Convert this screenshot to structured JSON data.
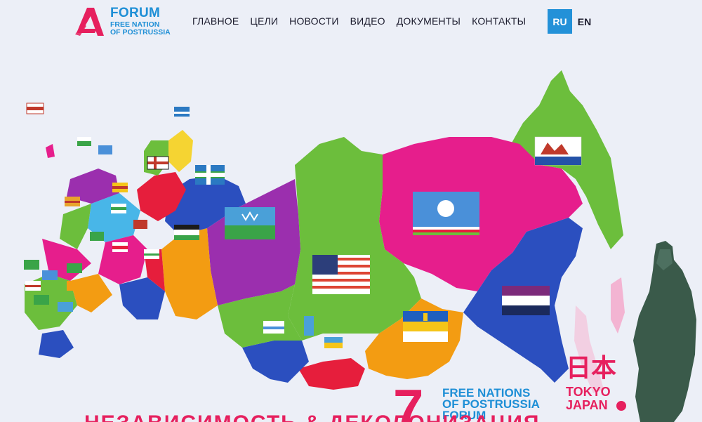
{
  "logo": {
    "title": "FORUM",
    "line1": "FREE NATION",
    "line2": "OF POSTRUSSIA",
    "brand_color": "#e6205e",
    "accent_color": "#1e8fd6"
  },
  "nav": {
    "items": [
      {
        "label": "ГЛАВНОЕ"
      },
      {
        "label": "ЦЕЛИ"
      },
      {
        "label": "НОВОСТИ"
      },
      {
        "label": "ВИДЕО"
      },
      {
        "label": "ДОКУМЕНТЫ"
      },
      {
        "label": "КОНТАКТЫ"
      }
    ]
  },
  "lang": {
    "active": "RU",
    "other": "EN",
    "active_color": "#2391d8"
  },
  "promo": {
    "number": "7",
    "line1": "FREE NATIONS",
    "line2": "OF POSTRUSSIA",
    "line3": "FORUM"
  },
  "japan": {
    "kanji": "日本",
    "city": "TOKYO",
    "country": "JAPAN"
  },
  "headline": "НЕЗАВИСИМОСТЬ & ДЕКОЛОНИЗАЦИЯ",
  "map": {
    "regions": [
      {
        "name": "far-east",
        "color": "#6cbe3c"
      },
      {
        "name": "sakha",
        "color": "#e61e8c"
      },
      {
        "name": "krasnoyarsk",
        "color": "#6cbe3c"
      },
      {
        "name": "khabarovsk",
        "color": "#2b4fbf"
      },
      {
        "name": "buryatia",
        "color": "#f39c12"
      },
      {
        "name": "tyva",
        "color": "#e61e3c"
      },
      {
        "name": "altai",
        "color": "#2b4fbf"
      },
      {
        "name": "ural",
        "color": "#f39c12"
      },
      {
        "name": "yamal",
        "color": "#9b2fae"
      },
      {
        "name": "komi",
        "color": "#2b4fbf"
      },
      {
        "name": "arkhangelsk",
        "color": "#e61e3c"
      },
      {
        "name": "west",
        "color": "#6cbe3c"
      }
    ],
    "flags": [
      {
        "name": "kamchatka-flag"
      },
      {
        "name": "sakha-flag"
      },
      {
        "name": "siberia-flag"
      },
      {
        "name": "far-east-flag"
      },
      {
        "name": "buryatia-flag"
      },
      {
        "name": "yugra-flag"
      },
      {
        "name": "komi-flag"
      },
      {
        "name": "ingria-flag"
      },
      {
        "name": "karelia-flag"
      }
    ]
  }
}
